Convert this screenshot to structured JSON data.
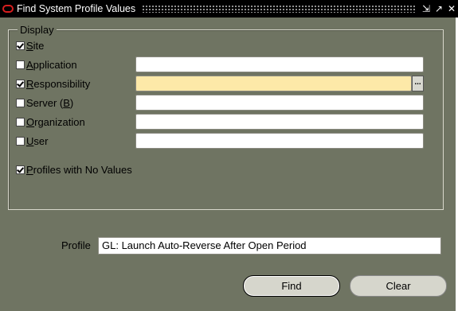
{
  "window": {
    "title": "Find System Profile Values"
  },
  "display_group": {
    "legend": "Display",
    "items": [
      {
        "label": "Site",
        "checked": true
      },
      {
        "label": "Application",
        "checked": false,
        "value": ""
      },
      {
        "label": "Responsibility",
        "checked": true,
        "value": ""
      },
      {
        "label": "Server (B)",
        "checked": false,
        "value": ""
      },
      {
        "label": "Organization",
        "checked": false,
        "value": ""
      },
      {
        "label": "User",
        "checked": false,
        "value": ""
      }
    ],
    "profiles_with_no_values": {
      "label": "Profiles with No Values",
      "checked": true
    },
    "lov_label": "..."
  },
  "profile": {
    "label": "Profile",
    "value": "GL: Launch Auto-Reverse After Open Period"
  },
  "buttons": {
    "find": "Find",
    "clear": "Clear"
  }
}
